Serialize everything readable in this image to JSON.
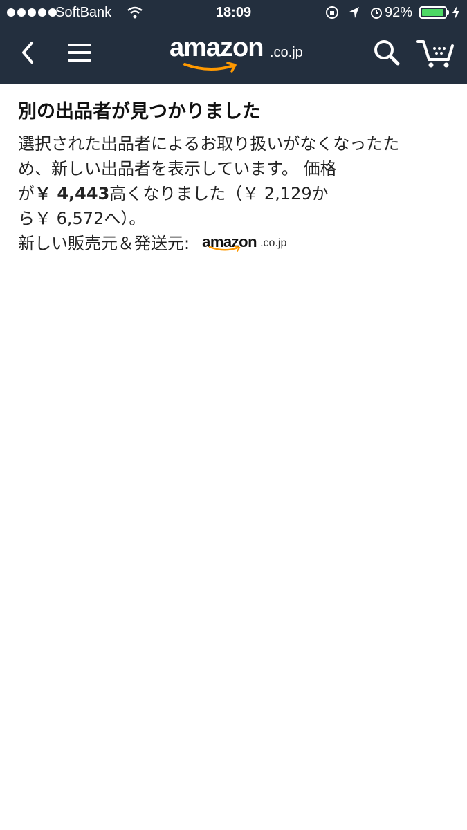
{
  "status_bar": {
    "carrier": "SoftBank",
    "time": "18:09",
    "battery_percent": "92%",
    "battery_level": 0.92,
    "icons": [
      "signal-dots-icon",
      "wifi-icon",
      "rotation-lock-icon",
      "location-arrow-icon",
      "alarm-icon",
      "battery-icon",
      "charging-bolt-icon"
    ]
  },
  "header": {
    "logo_word": "amazon",
    "logo_tld": ".co.jp",
    "colors": {
      "background": "#232f3e",
      "smile": "#ff9900"
    },
    "icons": [
      "back-chevron-icon",
      "menu-icon",
      "search-icon",
      "cart-icon"
    ]
  },
  "notice": {
    "title": "別の出品者が見つかりました",
    "line1": "選択された出品者によるお取り扱いがなくなったた",
    "line2": "め、新しい出品者を表示しています。 価格",
    "line3_prefix": "が",
    "price_increase": "￥ 4,443",
    "line3_suffix": "高くなりました（￥ 2,129か",
    "line4": "ら￥ 6,572へ）。",
    "seller_label": "新しい販売元＆発送元:",
    "seller_logo_word": "amazon",
    "seller_logo_tld": ".co.jp"
  }
}
